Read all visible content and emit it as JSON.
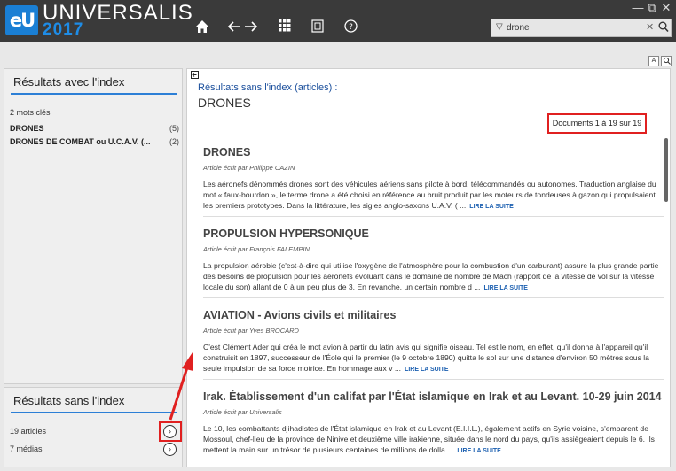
{
  "app": {
    "logo_text": "eU",
    "brand": "UNIVERSALIS",
    "year": "2017"
  },
  "nav": {
    "home_icon": "home-icon",
    "back_icon": "arrow-left-icon",
    "forward_icon": "arrow-right-icon",
    "grid_icon": "grid-icon",
    "media_icon": "media-icon",
    "help_icon": "help-icon"
  },
  "window": {
    "minimize": "—",
    "restore": "⧉",
    "close": "✕"
  },
  "search": {
    "value": "drone",
    "placeholder": ""
  },
  "side_index": {
    "title": "Résultats avec l'index",
    "count_label": "2 mots clés",
    "items": [
      {
        "label": "DRONES",
        "count": "(5)"
      },
      {
        "label": "DRONES DE COMBAT ou U.C.A.V. (...",
        "count": "(2)"
      }
    ]
  },
  "side_noindex": {
    "title": "Résultats sans l'index",
    "items": [
      {
        "label": "19 articles",
        "arrow": "›"
      },
      {
        "label": "7 médias",
        "arrow": "›"
      }
    ]
  },
  "results": {
    "label": "Résultats sans l'index (articles) :",
    "query": "DRONES",
    "docs_count": "Documents 1 à 19 sur 19",
    "read_more": "LIRE LA SUITE",
    "articles": [
      {
        "title": "DRONES",
        "author": "Article écrit par Philippe CAZIN",
        "text": "Les aéronefs dénommés drones sont des véhicules aériens sans pilote à bord, télécommandés ou autonomes. Traduction anglaise du mot « faux-bourdon », le terme drone a été choisi en référence au bruit produit par les moteurs de tondeuses à gazon qui propulsaient les premiers prototypes. Dans la littérature, les sigles anglo-saxons U.A.V. ( ..."
      },
      {
        "title": "PROPULSION HYPERSONIQUE",
        "author": "Article écrit par François FALEMPIN",
        "text": "La propulsion aérobie (c'est-à-dire qui utilise l'oxygène de l'atmosphère pour la combustion d'un carburant) assure la plus grande partie des besoins de propulsion pour les aéronefs évoluant dans le domaine de nombre de Mach (rapport de la vitesse de vol sur la vitesse locale du son) allant de 0 à un peu plus de 3. En revanche, un certain nombre d ..."
      },
      {
        "title": "AVIATION - Avions civils et militaires",
        "author": "Article écrit par Yves BROCARD",
        "text": "C'est Clément Ader qui créa le mot avion à partir du latin avis qui signifie oiseau. Tel est le nom, en effet, qu'il donna à l'appareil qu'il construisit en 1897, successeur de l'Éole qui le premier (le 9 octobre 1890) quitta le sol sur une distance d'environ 50 mètres sous la seule impulsion de sa force motrice. En hommage aux v ..."
      },
      {
        "title": "Irak. Établissement d'un califat par l'État islamique en Irak et au Levant. 10-29 juin 2014",
        "author": "Article écrit par Universalis",
        "text": "Le 10, les combattants djihadistes de l'État islamique en Irak et au Levant (E.I.I.L.), également actifs en Syrie voisine, s'emparent de Mossoul, chef-lieu de la province de Ninive et deuxième ville irakienne, située dans le nord du pays, qu'ils assiègeaient depuis le 6. Ils mettent la main sur un trésor de plusieurs centaines de millions de dolla ..."
      }
    ]
  },
  "colors": {
    "accent": "#1e8ce6",
    "link": "#1b5fb0",
    "highlight": "#e02020",
    "titlebar": "#3a3a3a"
  }
}
